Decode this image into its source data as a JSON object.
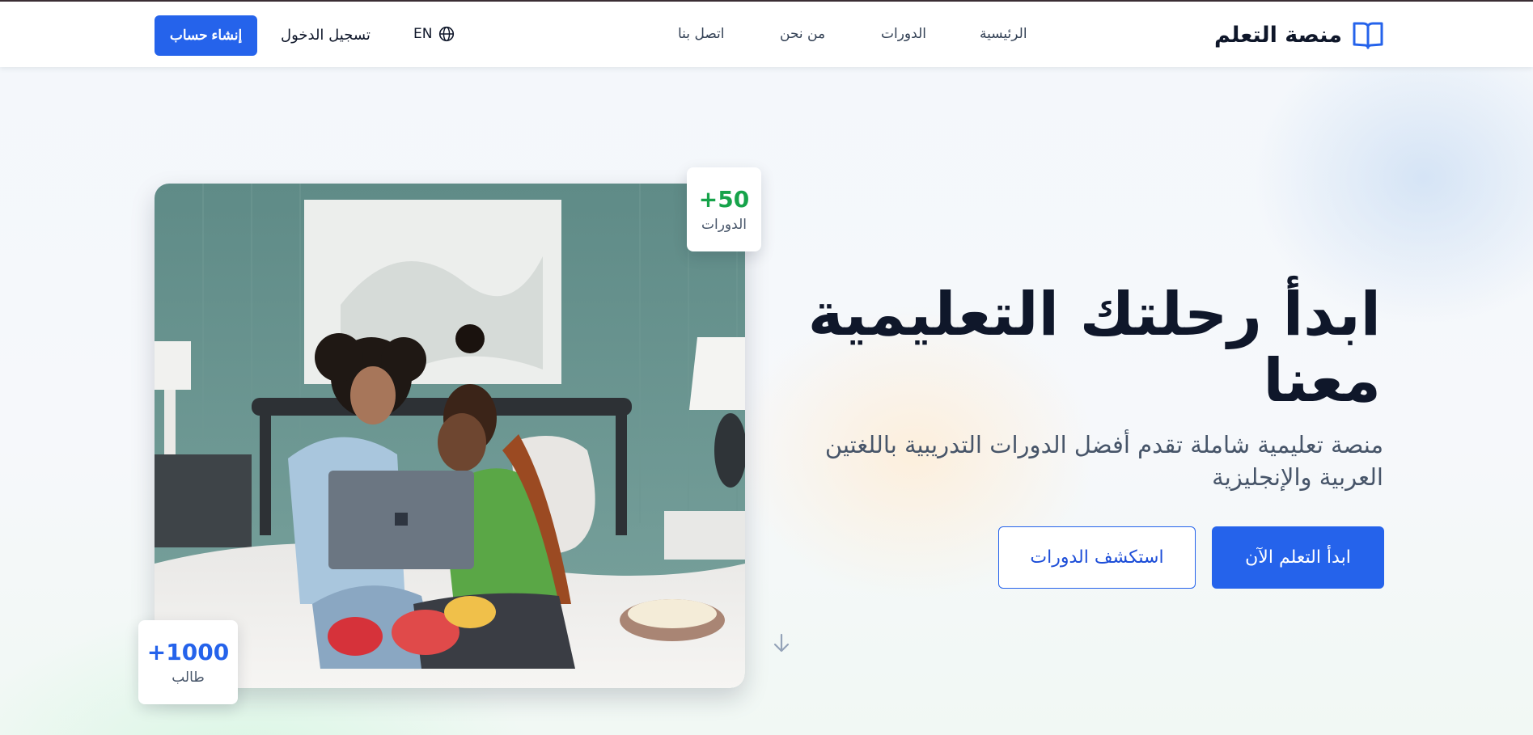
{
  "nav": {
    "brand": "منصة التعلم",
    "links": [
      "الرئيسية",
      "الدورات",
      "من نحن",
      "اتصل بنا"
    ],
    "lang": "EN",
    "login": "تسجيل الدخول",
    "signup": "إنشاء حساب"
  },
  "hero": {
    "title_line1": "ابدأ رحلتك التعليمية",
    "title_line2": "معنا",
    "subtitle_line1": "منصة تعليمية شاملة تقدم أفضل الدورات التدريبية باللغتين",
    "subtitle_line2": "العربية والإنجليزية",
    "primary_button": "ابدأ التعلم الآن",
    "secondary_button": "استكشف الدورات"
  },
  "stats": {
    "courses": {
      "value": "+50",
      "label": "الدورات"
    },
    "students": {
      "value": "+1000",
      "label": "طالب"
    }
  },
  "colors": {
    "primary": "#2563eb",
    "courses_stat": "#16a34a",
    "students_stat": "#2563eb"
  }
}
